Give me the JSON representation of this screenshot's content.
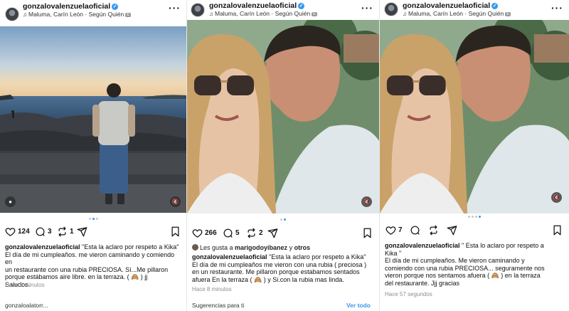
{
  "posts": [
    {
      "username": "gonzalovalenzuelaoficial",
      "music": "Maluma, Carín León · Según Quién",
      "music_badge": "E",
      "likes": "124",
      "comments": "3",
      "reposts": "1",
      "caption_user": "gonzalovalenzuelaoficial",
      "caption_lines": [
        " \"Esta la aclaro por respeto a Kika\"",
        "El día de mi cumpleaños. me vieron caminando y comiendo en",
        "un restaurante con una rubia PRECIOSA.   Sí...Me pillaron",
        "porque estábamos aire libre. en  la terraza. ( 🙈 ) jj",
        "Saludos."
      ],
      "time": "Hace 6 minutos",
      "bottom_cut": "gonzaloalatorr..."
    },
    {
      "username": "gonzalovalenzuelaoficial",
      "music": "Maluma, Carín León · Según Quién",
      "music_badge": "E",
      "likes": "266",
      "comments": "5",
      "reposts": "2",
      "liked_by_prefix": "Les gusta a ",
      "liked_by_user": "marigodoyibanez",
      "liked_by_mid": " y ",
      "liked_by_others": "otros",
      "caption_user": "gonzalovalenzuelaoficial",
      "caption_lines": [
        " \"Esta la aclaro por respeto a Kika\"",
        " El día de mi cumpleaños me vieron con una rubia ( preciosa )",
        "en un restaurante. Me pillaron  porque estabamos sentados",
        "afuera En la terraza ( 🙈 ) y Si.con la rubia mas linda."
      ],
      "time": "Hace 8 minutos",
      "bottom_cut_left": "Sugerencias para ti",
      "bottom_cut_right": "Ver todo"
    },
    {
      "username": "gonzalovalenzuelaoficial",
      "music": "Maluma, Carín León · Según Quién",
      "music_badge": "E",
      "likes": "7",
      "caption_user": "gonzalovalenzuelaoficial",
      "caption_lines": [
        " \" Esta lo aclaro por respeto a",
        "Kika \"",
        "El día de mi cumpleaños. Me vieron caminando y",
        "comiendo con una rubia PRECIOSA... seguramente nos",
        "vieron  porque nos sentamos afuera ( 🙈 ) en la terraza",
        "del restaurante. Jjj gracias"
      ],
      "time": "Hace 57 segundos"
    }
  ],
  "colors": {
    "verified": "#3897f0",
    "active_dot": "#3897f0",
    "secondary_text": "#8e8e8e"
  },
  "icons": [
    "verified-icon",
    "music-note-icon",
    "more-icon",
    "heart-icon",
    "comment-icon",
    "repost-icon",
    "share-icon",
    "save-icon",
    "user-tag-icon",
    "muted-icon"
  ]
}
